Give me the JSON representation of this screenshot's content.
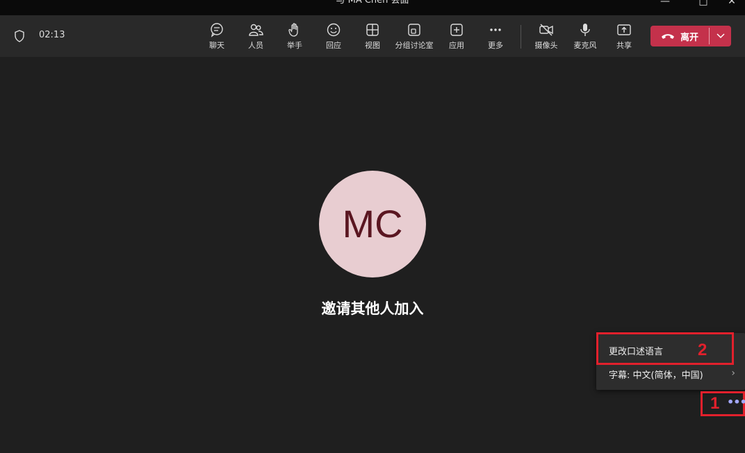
{
  "window": {
    "title": "与 MA Chen 会面"
  },
  "toolbar": {
    "timer": "02:13",
    "buttons": {
      "chat": "聊天",
      "people": "人员",
      "raise_hand": "举手",
      "react": "回应",
      "view": "视图",
      "breakout": "分组讨论室",
      "apps": "应用",
      "more": "更多",
      "camera": "摄像头",
      "mic": "麦克风",
      "share": "共享"
    },
    "leave": "离开"
  },
  "stage": {
    "avatar_initials": "MC",
    "invite_text": "邀请其他人加入"
  },
  "context_menu": {
    "items": [
      {
        "label": "更改口述语言"
      },
      {
        "label": "字幕: 中文(简体，中国)"
      }
    ]
  },
  "annotations": {
    "one": "1",
    "two": "2"
  },
  "colors": {
    "accent_red": "#c4314b",
    "annotation_red": "#e2202c",
    "avatar_bg": "#e8cdd1"
  }
}
